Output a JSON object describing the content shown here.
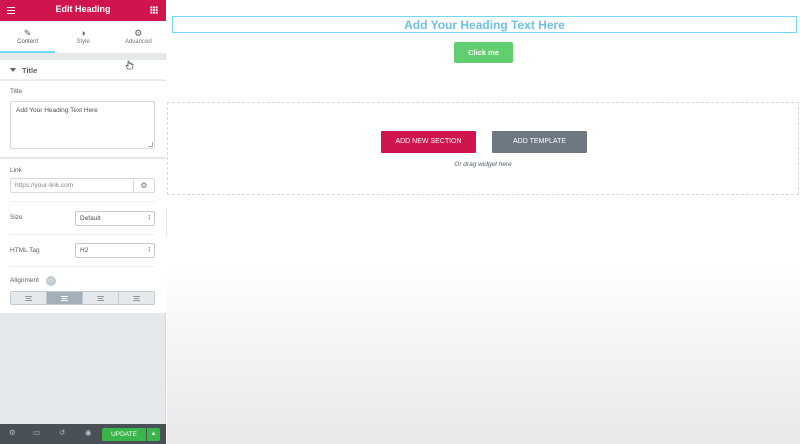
{
  "panel": {
    "title": "Edit Heading",
    "menu_icon": "hamburger-icon",
    "apps_icon": "grid-icon",
    "tabs": [
      {
        "label": "Content",
        "icon": "pencil-icon",
        "active": true
      },
      {
        "label": "Style",
        "icon": "half-circle-icon",
        "active": false
      },
      {
        "label": "Advanced",
        "icon": "gear-icon",
        "active": false
      }
    ],
    "section_title": "Title",
    "title_label": "Title",
    "title_value": "Add Your Heading Text Here",
    "link_label": "Link",
    "link_placeholder": "https://your-link.com",
    "size_label": "Size",
    "size_value": "Default",
    "tag_label": "HTML Tag",
    "tag_value": "H2",
    "alignment_label": "Alignment",
    "alignment_selected": "center",
    "accent_color": "#d0154e"
  },
  "footer": {
    "update_label": "UPDATE",
    "update_caret": "▲"
  },
  "canvas": {
    "heading_text": "Add Your Heading Text Here",
    "button_label": "Click me",
    "add_section_label": "ADD NEW SECTION",
    "add_template_label": "ADD TEMPLATE",
    "drag_hint": "Or drag widget here"
  }
}
